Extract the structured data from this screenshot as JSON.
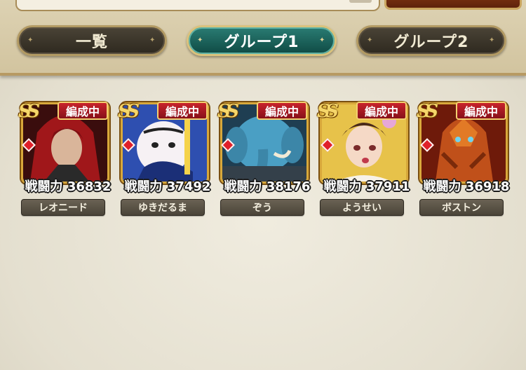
{
  "tabs": [
    {
      "label": "一覧",
      "active": false
    },
    {
      "label": "グループ1",
      "active": true
    },
    {
      "label": "グループ2",
      "active": false
    }
  ],
  "cards": [
    {
      "rank": "SS",
      "status": "編成中",
      "power": "戦闘力 36832",
      "name": "レオニード",
      "bg": "#5a1414",
      "accent": "#b1201c"
    },
    {
      "rank": "SS",
      "status": "編成中",
      "power": "戦闘力 37492",
      "name": "ゆきだるま",
      "bg": "#2e4fb0",
      "accent": "#f6f1f4"
    },
    {
      "rank": "SS",
      "status": "編成中",
      "power": "戦闘力 38176",
      "name": "ぞう",
      "bg": "#1f4f6b",
      "accent": "#4a9fc4"
    },
    {
      "rank": "SS",
      "status": "編成中",
      "power": "戦闘力 37911",
      "name": "ようせい",
      "bg": "#e7c24a",
      "accent": "#f5d9c6"
    },
    {
      "rank": "SS",
      "status": "編成中",
      "power": "戦闘力 36918",
      "name": "ボストン",
      "bg": "#9b2b10",
      "accent": "#d46a1a"
    }
  ]
}
